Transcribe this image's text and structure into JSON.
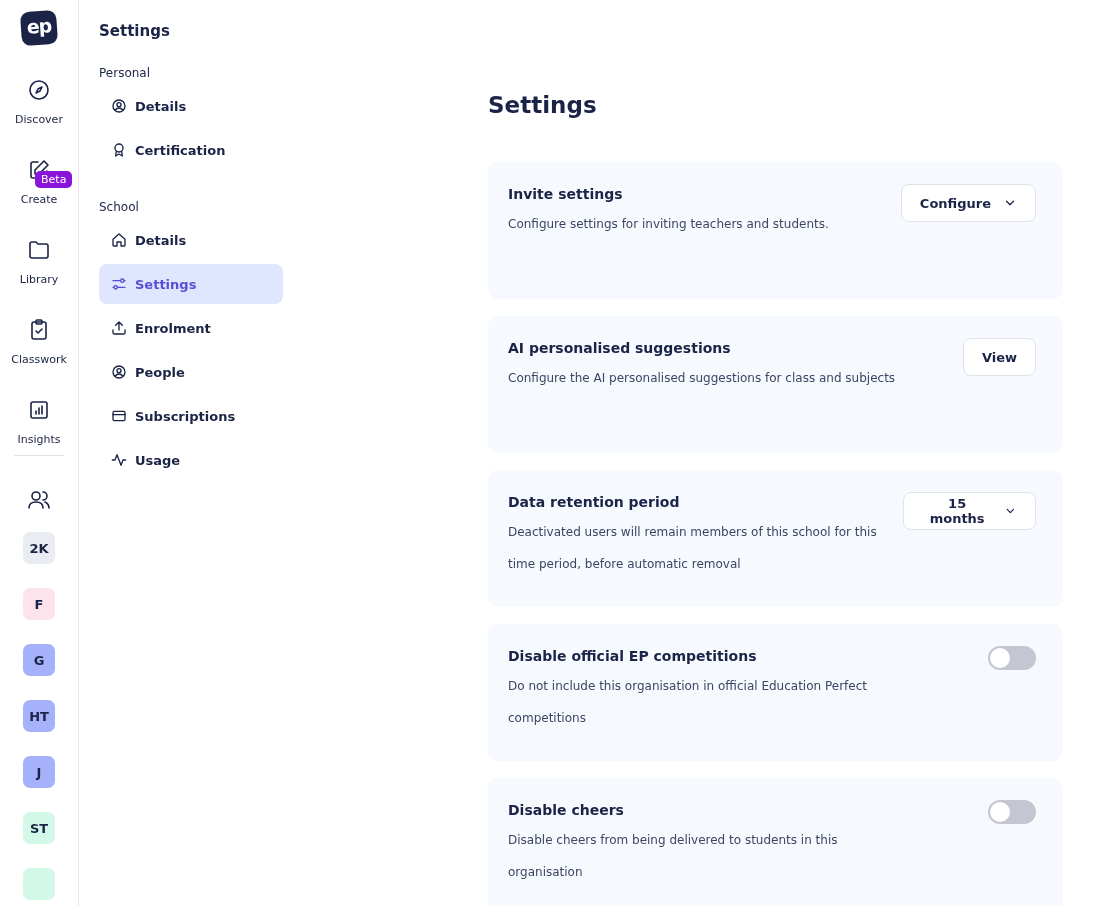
{
  "rail": {
    "logo": "ep",
    "items": [
      {
        "kind": "discover",
        "label": "Discover"
      },
      {
        "kind": "create",
        "label": "Create",
        "badge": "Beta"
      },
      {
        "kind": "library",
        "label": "Library"
      },
      {
        "kind": "classwork",
        "label": "Classwork"
      },
      {
        "kind": "insights",
        "label": "Insights"
      }
    ],
    "groups": [
      {
        "label": "2K",
        "color": "#e9edf3"
      },
      {
        "label": "F",
        "color": "#fde3ec"
      },
      {
        "label": "G",
        "color": "#a5b1fb"
      },
      {
        "label": "HT",
        "color": "#a5b1fb"
      },
      {
        "label": "J",
        "color": "#a5b1fb"
      },
      {
        "label": "ST",
        "color": "#d4f8e8"
      },
      {
        "color": "#d4f8e8"
      }
    ]
  },
  "nav": {
    "title": "Settings",
    "sections": [
      {
        "heading": "Personal",
        "items": [
          {
            "label": "Details",
            "selected": false
          },
          {
            "label": "Certification",
            "selected": false
          }
        ]
      },
      {
        "heading": "School",
        "items": [
          {
            "label": "Details",
            "selected": false
          },
          {
            "label": "Settings",
            "selected": true
          },
          {
            "label": "Enrolment",
            "selected": false
          },
          {
            "label": "People",
            "selected": false
          },
          {
            "label": "Subscriptions",
            "selected": false
          },
          {
            "label": "Usage",
            "selected": false
          }
        ]
      }
    ]
  },
  "main": {
    "title": "Settings",
    "cards": [
      {
        "kind": "dropdown",
        "title": "Invite settings",
        "description": "Configure settings for inviting teachers and students.",
        "control": "Configure"
      },
      {
        "kind": "button",
        "title": "AI personalised suggestions",
        "description": "Configure the AI personalised suggestions for class and subjects",
        "control": "View"
      },
      {
        "kind": "dropdown",
        "title": "Data retention period",
        "description": "Deactivated users will remain members of this school for this time period, before automatic removal",
        "control": "15 months"
      },
      {
        "kind": "toggle",
        "title": "Disable official EP competitions",
        "description": "Do not include this organisation in official Education Perfect competitions",
        "on": false
      },
      {
        "kind": "toggle",
        "title": "Disable cheers",
        "description": "Disable cheers from being delivered to students in this organisation",
        "on": false
      }
    ]
  }
}
